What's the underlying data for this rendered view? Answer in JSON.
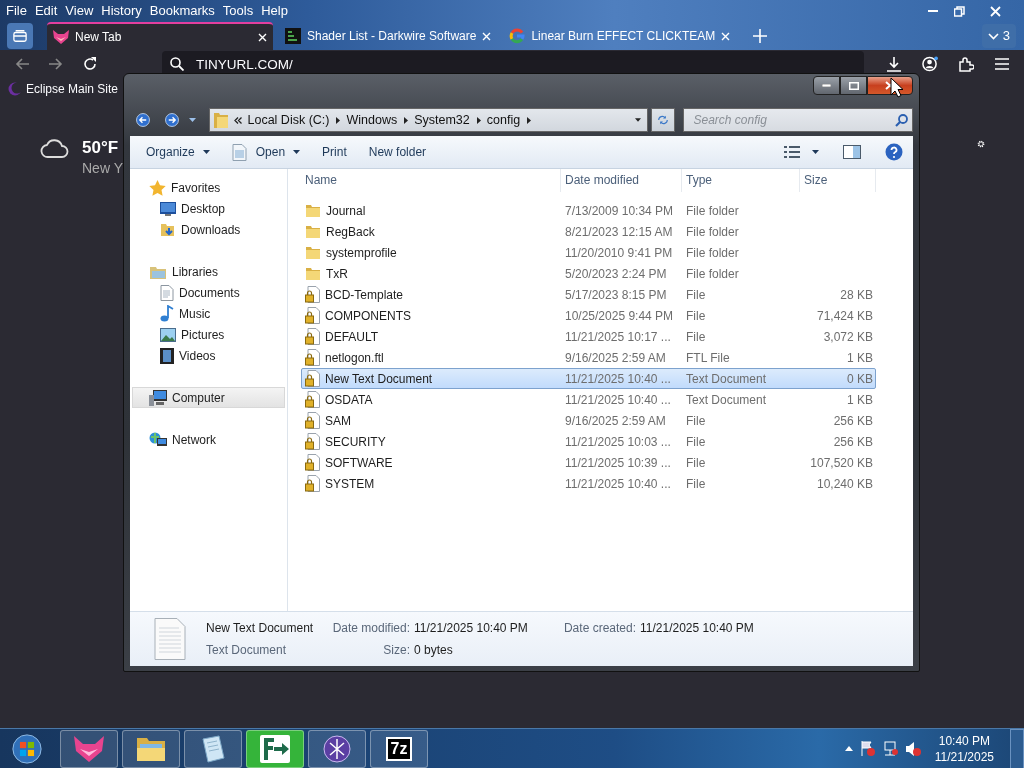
{
  "browser": {
    "menu": [
      "File",
      "Edit",
      "View",
      "History",
      "Bookmarks",
      "Tools",
      "Help"
    ],
    "tabs": [
      {
        "title": "New Tab",
        "kind": "fox",
        "selected": true
      },
      {
        "title": "Shader List - Darkwire Software",
        "kind": "darkapp",
        "selected": false
      },
      {
        "title": "Linear Burn EFFECT CLICKTEAM",
        "kind": "ring",
        "selected": false
      }
    ],
    "tab_count": "3",
    "url": "TINYURL.COM/",
    "bookmarks": [
      "Eclipse Main Site"
    ]
  },
  "weather": {
    "temperature": "50°F",
    "location": "New Y"
  },
  "explorer": {
    "breadcrumb": [
      "Local Disk (C:)",
      "Windows",
      "System32",
      "config"
    ],
    "search": {
      "placeholder": "Search config"
    },
    "toolbar": [
      {
        "label": "Organize",
        "kind": "menu"
      },
      {
        "label": "Open",
        "kind": "open"
      },
      {
        "label": "Print",
        "kind": "plain"
      },
      {
        "label": "New folder",
        "kind": "plain"
      }
    ],
    "nav": [
      {
        "label": "Favorites",
        "kind": "star",
        "selected": false,
        "children": [
          {
            "label": "Desktop",
            "kind": "desktop",
            "selected": false
          },
          {
            "label": "Downloads",
            "kind": "downloads",
            "selected": false
          }
        ]
      },
      {
        "label": "Libraries",
        "kind": "library",
        "selected": false,
        "children": [
          {
            "label": "Documents",
            "kind": "document",
            "selected": false
          },
          {
            "label": "Music",
            "kind": "music",
            "selected": false
          },
          {
            "label": "Pictures",
            "kind": "pictures",
            "selected": false
          },
          {
            "label": "Videos",
            "kind": "videos",
            "selected": false
          }
        ]
      },
      {
        "label": "Computer",
        "kind": "computer",
        "selected": true
      },
      {
        "label": "Network",
        "kind": "network",
        "selected": false
      }
    ],
    "columns": [
      "Name",
      "Date modified",
      "Type",
      "Size"
    ],
    "files": [
      {
        "name": "Journal",
        "date": "7/13/2009 10:34 PM",
        "type": "File folder",
        "kind": "folder",
        "selected": false
      },
      {
        "name": "RegBack",
        "date": "8/21/2023 12:15 AM",
        "type": "File folder",
        "kind": "folder",
        "selected": false
      },
      {
        "name": "systemprofile",
        "date": "11/20/2010 9:41 PM",
        "type": "File folder",
        "kind": "folder",
        "selected": false
      },
      {
        "name": "TxR",
        "date": "5/20/2023 2:24 PM",
        "type": "File folder",
        "kind": "folder",
        "selected": false
      },
      {
        "name": "BCD-Template",
        "date": "5/17/2023 8:15 PM",
        "type": "File",
        "size": "28 KB",
        "kind": "locked",
        "selected": false
      },
      {
        "name": "COMPONENTS",
        "date": "10/25/2025 9:44 PM",
        "type": "File",
        "size": "71,424 KB",
        "kind": "locked",
        "selected": false
      },
      {
        "name": "DEFAULT",
        "date": "11/21/2025 10:17 ...",
        "type": "File",
        "size": "3,072 KB",
        "kind": "locked",
        "selected": false
      },
      {
        "name": "netlogon.ftl",
        "date": "9/16/2025 2:59 AM",
        "type": "FTL File",
        "size": "1 KB",
        "kind": "locked",
        "selected": false
      },
      {
        "name": "New Text Document",
        "date": "11/21/2025 10:40 ...",
        "type": "Text Document",
        "size": "0 KB",
        "kind": "locked",
        "selected": true
      },
      {
        "name": "OSDATA",
        "date": "11/21/2025 10:40 ...",
        "type": "Text Document",
        "size": "1 KB",
        "kind": "locked",
        "selected": false
      },
      {
        "name": "SAM",
        "date": "9/16/2025 2:59 AM",
        "type": "File",
        "size": "256 KB",
        "kind": "locked",
        "selected": false
      },
      {
        "name": "SECURITY",
        "date": "11/21/2025 10:03 ...",
        "type": "File",
        "size": "256 KB",
        "kind": "locked",
        "selected": false
      },
      {
        "name": "SOFTWARE",
        "date": "11/21/2025 10:39 ...",
        "type": "File",
        "size": "107,520 KB",
        "kind": "locked",
        "selected": false
      },
      {
        "name": "SYSTEM",
        "date": "11/21/2025 10:40 ...",
        "type": "File",
        "size": "10,240 KB",
        "kind": "locked",
        "selected": false
      }
    ],
    "details": {
      "name": "New Text Document",
      "type": "Text Document",
      "fields": [
        {
          "label": "Date modified:",
          "value": "11/21/2025 10:40 PM"
        },
        {
          "label": "Date created:",
          "value": "11/21/2025 10:40 PM"
        },
        {
          "label": "Size:",
          "value": "0 bytes"
        }
      ]
    }
  },
  "taskbar": {
    "apps": [
      {
        "kind": "fox"
      },
      {
        "kind": "explorer"
      },
      {
        "kind": "notepad"
      },
      {
        "kind": "arrowapp"
      },
      {
        "kind": "eclipse"
      },
      {
        "kind": "archiver",
        "label": "7z"
      }
    ],
    "time": "10:40 PM",
    "date": "11/21/2025"
  }
}
